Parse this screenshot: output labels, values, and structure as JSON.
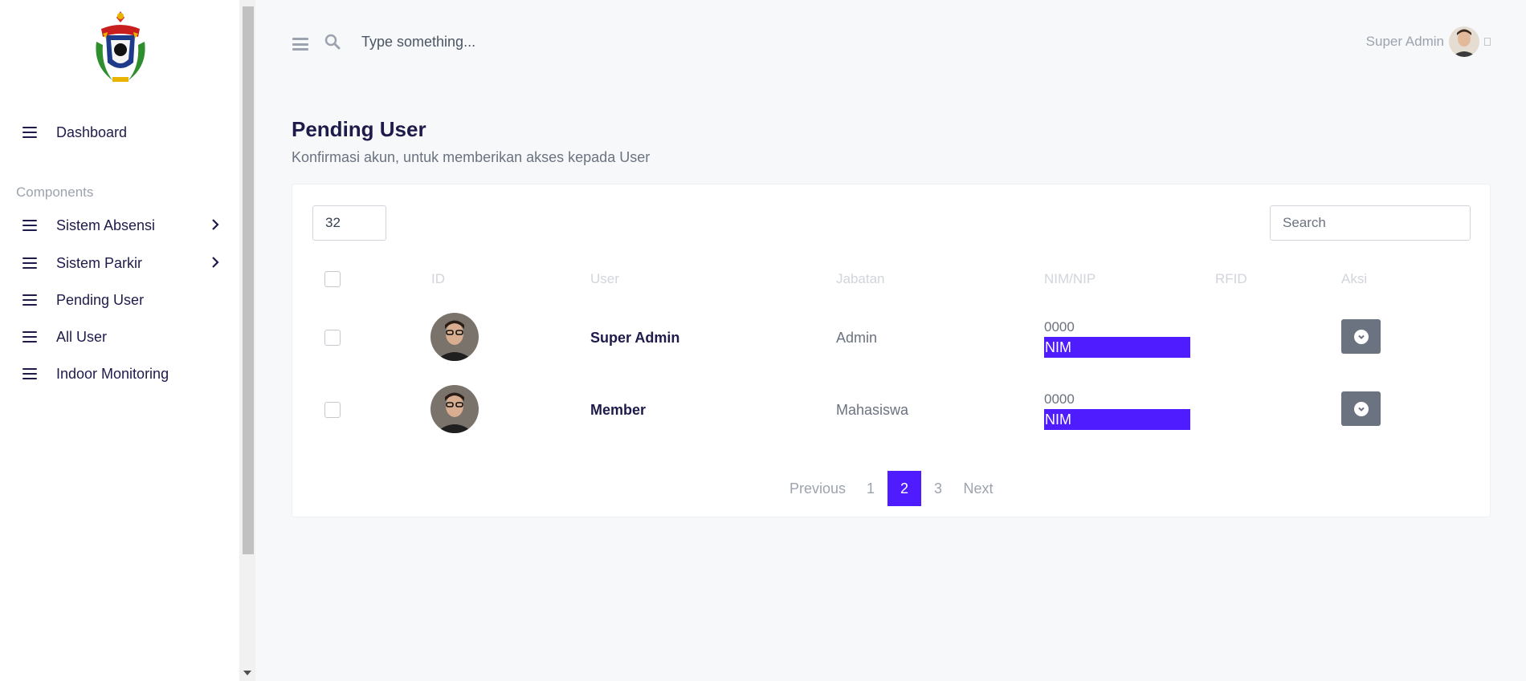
{
  "colors": {
    "accent": "#4f1cff",
    "action_button": "#6b7280",
    "sidebar_bg": "#ffffff",
    "page_bg": "#f7f8fa"
  },
  "sidebar": {
    "logo_icon": "university-crest-icon",
    "top_items": [
      {
        "label": "Dashboard",
        "icon": "menu-icon"
      }
    ],
    "section_label": "Components",
    "items": [
      {
        "label": "Sistem Absensi",
        "icon": "menu-icon",
        "has_submenu": true
      },
      {
        "label": "Sistem Parkir",
        "icon": "menu-icon",
        "has_submenu": true
      },
      {
        "label": "Pending User",
        "icon": "menu-icon",
        "has_submenu": false
      },
      {
        "label": "All User",
        "icon": "menu-icon",
        "has_submenu": false
      },
      {
        "label": "Indoor Monitoring",
        "icon": "menu-icon",
        "has_submenu": false
      }
    ]
  },
  "header": {
    "search_placeholder": "Type something...",
    "user_name": "Super Admin"
  },
  "page": {
    "title": "Pending User",
    "subtitle": "Konfirmasi akun, untuk memberikan akses kepada User"
  },
  "table": {
    "page_length": "32",
    "search_placeholder": "Search",
    "columns": [
      "ID",
      "User",
      "Jabatan",
      "NIM/NIP",
      "RFID",
      "Aksi"
    ],
    "rows": [
      {
        "user": "Super Admin",
        "jabatan": "Admin",
        "nim": "0000",
        "badge": "NIM",
        "rfid": ""
      },
      {
        "user": "Member",
        "jabatan": "Mahasiswa",
        "nim": "0000",
        "badge": "NIM",
        "rfid": ""
      }
    ]
  },
  "pagination": {
    "previous": "Previous",
    "pages": [
      "1",
      "2",
      "3"
    ],
    "current": "2",
    "next": "Next"
  }
}
